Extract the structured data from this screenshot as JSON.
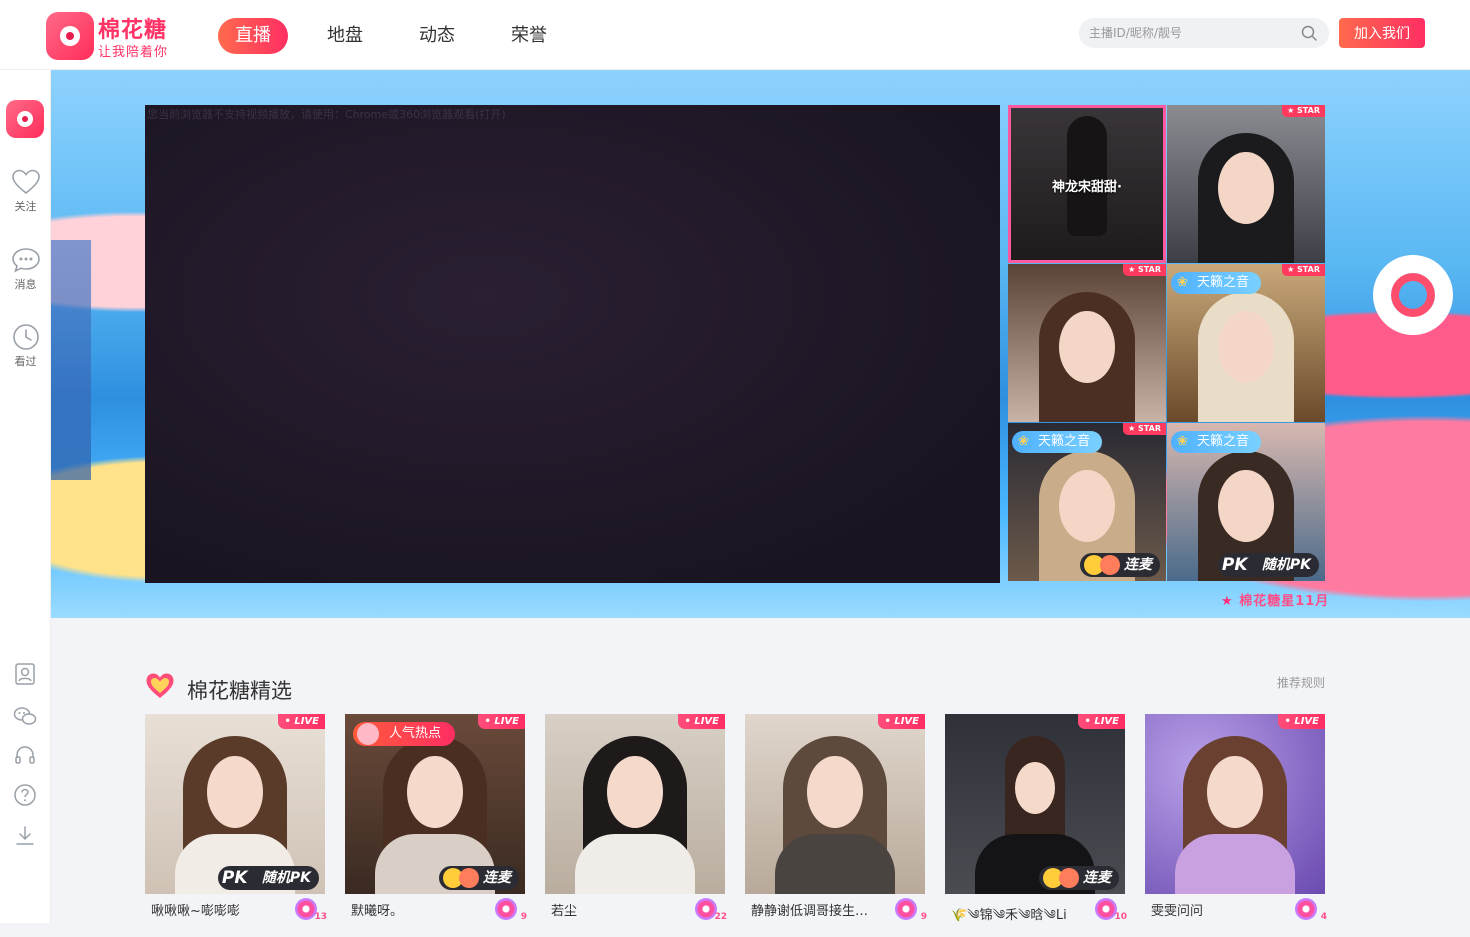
{
  "brand": {
    "name": "棉花糖",
    "slogan": "让我陪着你"
  },
  "nav": {
    "items": [
      {
        "label": "直播",
        "active": true
      },
      {
        "label": "地盘",
        "active": false
      },
      {
        "label": "动态",
        "active": false
      },
      {
        "label": "荣誉",
        "active": false
      }
    ]
  },
  "search": {
    "placeholder": "主播ID/昵称/靓号"
  },
  "header": {
    "join_label": "加入我们"
  },
  "sidebar": {
    "items": [
      {
        "label": "关注",
        "icon": "heart-icon"
      },
      {
        "label": "消息",
        "icon": "chat-icon"
      },
      {
        "label": "看过",
        "icon": "clock-icon"
      }
    ],
    "tools": [
      "profile-icon",
      "wechat-icon",
      "headset-icon",
      "help-icon",
      "download-icon"
    ]
  },
  "player": {
    "tip": "您当前浏览器不支持视频播放，请使用：Chrome或360浏览器观看(打开)"
  },
  "featured": {
    "selected_name": "神龙宋甜甜·",
    "tags": {
      "star": "STAR",
      "sky": "天籁之音",
      "lianmai": "连麦",
      "pk": "随机PK"
    },
    "caption": "棉花糖星11月"
  },
  "section": {
    "title": "棉花糖精选",
    "rule_link": "推荐规则"
  },
  "cards": [
    {
      "name": "啾啾啾~嘭嘭嘭",
      "level": "13",
      "badge": "pk"
    },
    {
      "name": "默曦呀。",
      "level": "9",
      "badge": "lianmai",
      "hot": "人气热点"
    },
    {
      "name": "若尘",
      "level": "22",
      "badge": ""
    },
    {
      "name": "静静谢低调哥接生…",
      "level": "9",
      "badge": ""
    },
    {
      "name": "🌾༄锦༄禾༄晗༄Li",
      "level": "10",
      "badge": "lianmai"
    },
    {
      "name": "雯雯问问",
      "level": "4",
      "badge": ""
    }
  ],
  "live_label": "LIVE",
  "colors": {
    "accent": "#ff2e63",
    "accent_start": "#ff6a4d"
  }
}
